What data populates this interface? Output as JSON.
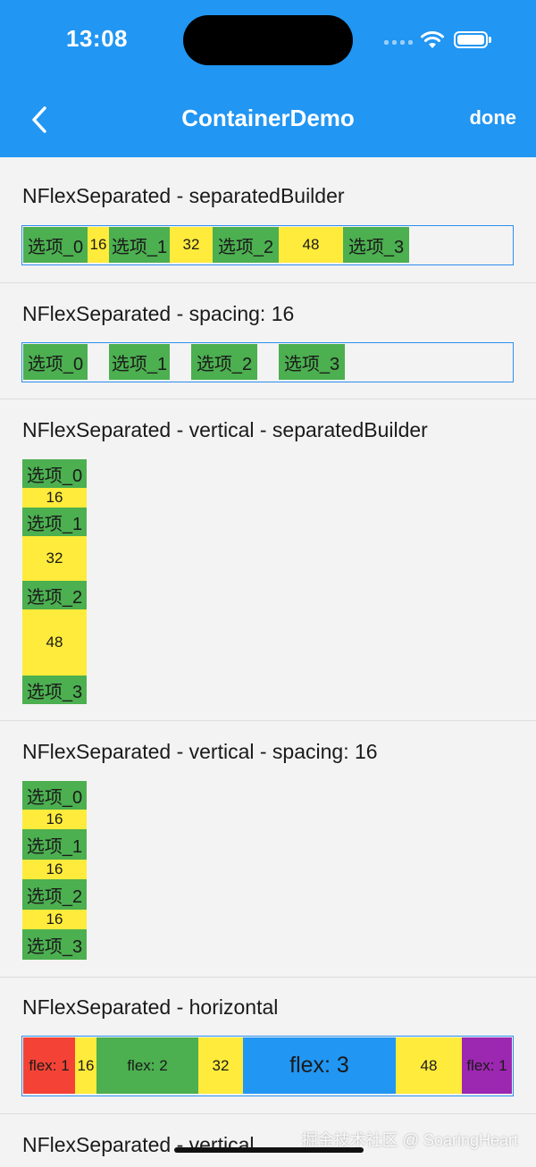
{
  "status_bar": {
    "time": "13:08"
  },
  "header": {
    "title": "ContainerDemo",
    "done_label": "done"
  },
  "sections": [
    {
      "title": "NFlexSeparated - separatedBuilder",
      "items": [
        "选项_0",
        "16",
        "选项_1",
        "32",
        "选项_2",
        "48",
        "选项_3"
      ]
    },
    {
      "title": "NFlexSeparated - spacing: 16",
      "items": [
        "选项_0",
        "选项_1",
        "选项_2",
        "选项_3"
      ]
    },
    {
      "title": "NFlexSeparated - vertical - separatedBuilder",
      "items": [
        "选项_0",
        "16",
        "选项_1",
        "32",
        "选项_2",
        "48",
        "选项_3"
      ]
    },
    {
      "title": "NFlexSeparated - vertical - spacing: 16",
      "items": [
        "选项_0",
        "16",
        "选项_1",
        "16",
        "选项_2",
        "16",
        "选项_3"
      ]
    },
    {
      "title": "NFlexSeparated - horizontal",
      "items": [
        "flex: 1",
        "16",
        "flex: 2",
        "32",
        "flex: 3",
        "48",
        "flex: 1"
      ]
    },
    {
      "title": "NFlexSeparated - vertical"
    }
  ],
  "colors": {
    "appbar": "#2196f3",
    "item_green": "#4caf50",
    "separator_yellow": "#ffeb3b",
    "flex_red": "#f44336",
    "flex_blue": "#2196f3",
    "flex_purple": "#9c27b0",
    "frame_border": "#2b8ef0"
  },
  "icons": [
    "back-chevron-icon",
    "wifi-icon",
    "battery-icon",
    "cellular-signal-icon"
  ],
  "watermark": "掘金技术社区 @ SoaringHeart"
}
